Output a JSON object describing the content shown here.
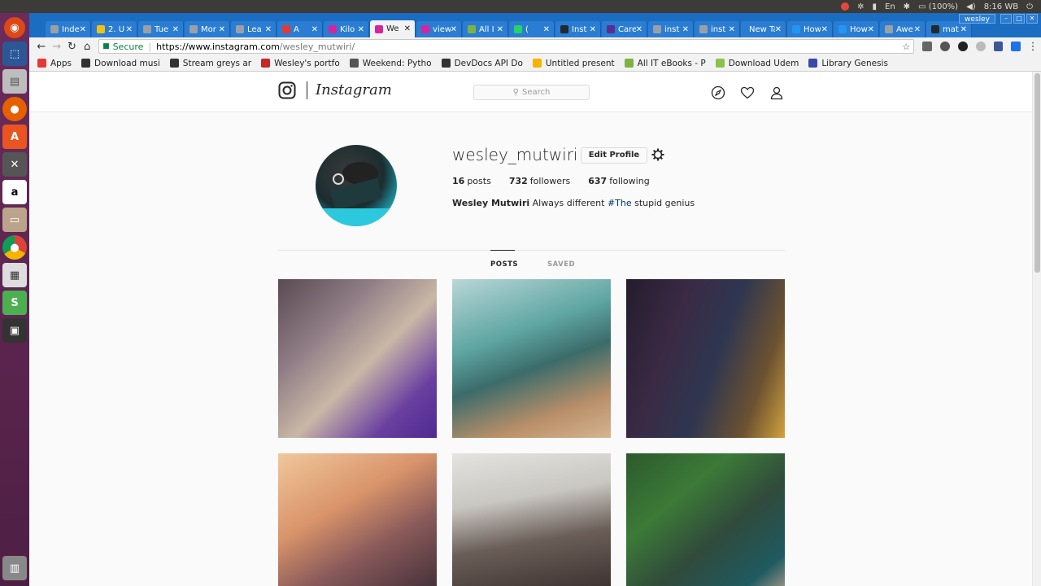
{
  "system": {
    "battery": "(100%)",
    "clock": "8:16 WB"
  },
  "window": {
    "user": "wesley"
  },
  "tabs": [
    {
      "label": "Inde",
      "color": "#9aa0a6"
    },
    {
      "label": "2. U",
      "color": "#f4c20d"
    },
    {
      "label": "Tue",
      "color": "#9aa0a6"
    },
    {
      "label": "Mor",
      "color": "#9aa0a6"
    },
    {
      "label": "Lea",
      "color": "#9aa0a6"
    },
    {
      "label": "A",
      "color": "#e53935"
    },
    {
      "label": "Kilo",
      "color": "#d6249f"
    },
    {
      "label": "We",
      "color": "#d6249f",
      "active": true
    },
    {
      "label": "view",
      "color": "#d6249f"
    },
    {
      "label": "All I",
      "color": "#7cb342"
    },
    {
      "label": "( ",
      "color": "#25d366"
    },
    {
      "label": "Inst",
      "color": "#24292e"
    },
    {
      "label": "Care",
      "color": "#5b2d8e"
    },
    {
      "label": "inst",
      "color": "#9aa0a6"
    },
    {
      "label": "inst",
      "color": "#9aa0a6"
    },
    {
      "label": "New Ta",
      "color": ""
    },
    {
      "label": "How",
      "color": "#2196f3"
    },
    {
      "label": "How",
      "color": "#2196f3"
    },
    {
      "label": "Awe",
      "color": "#9aa0a6"
    },
    {
      "label": "mat",
      "color": "#24292e"
    }
  ],
  "omnibox": {
    "secure_label": "Secure",
    "url_host": "https://www.instagram.com",
    "url_path": "/wesley_mutwiri/"
  },
  "bookmarks": [
    {
      "label": "Apps",
      "color": "#e53935"
    },
    {
      "label": "Download musi",
      "color": "#333333"
    },
    {
      "label": "Stream greys ar",
      "color": "#333333"
    },
    {
      "label": "Wesley's portfo",
      "color": "#c62828"
    },
    {
      "label": "Weekend: Pytho",
      "color": "#555555"
    },
    {
      "label": "DevDocs API Do",
      "color": "#333333"
    },
    {
      "label": "Untitled present",
      "color": "#f4b400"
    },
    {
      "label": "All IT eBooks - P",
      "color": "#7cb342"
    },
    {
      "label": "Download Udem",
      "color": "#8bc34a"
    },
    {
      "label": "Library Genesis",
      "color": "#3949ab"
    }
  ],
  "instagram": {
    "wordmark": "Instagram",
    "search_placeholder": "Search",
    "profile": {
      "username": "wesley_mutwiri",
      "edit_label": "Edit Profile",
      "posts_count": "16",
      "posts_label": "posts",
      "followers_count": "732",
      "followers_label": "followers",
      "following_count": "637",
      "following_label": "following",
      "full_name": "Wesley Mutwiri",
      "bio_text": "Always different",
      "bio_tag": "#The",
      "bio_tail": "stupid genius"
    },
    "tabs": {
      "posts": "POSTS",
      "saved": "SAVED"
    }
  }
}
